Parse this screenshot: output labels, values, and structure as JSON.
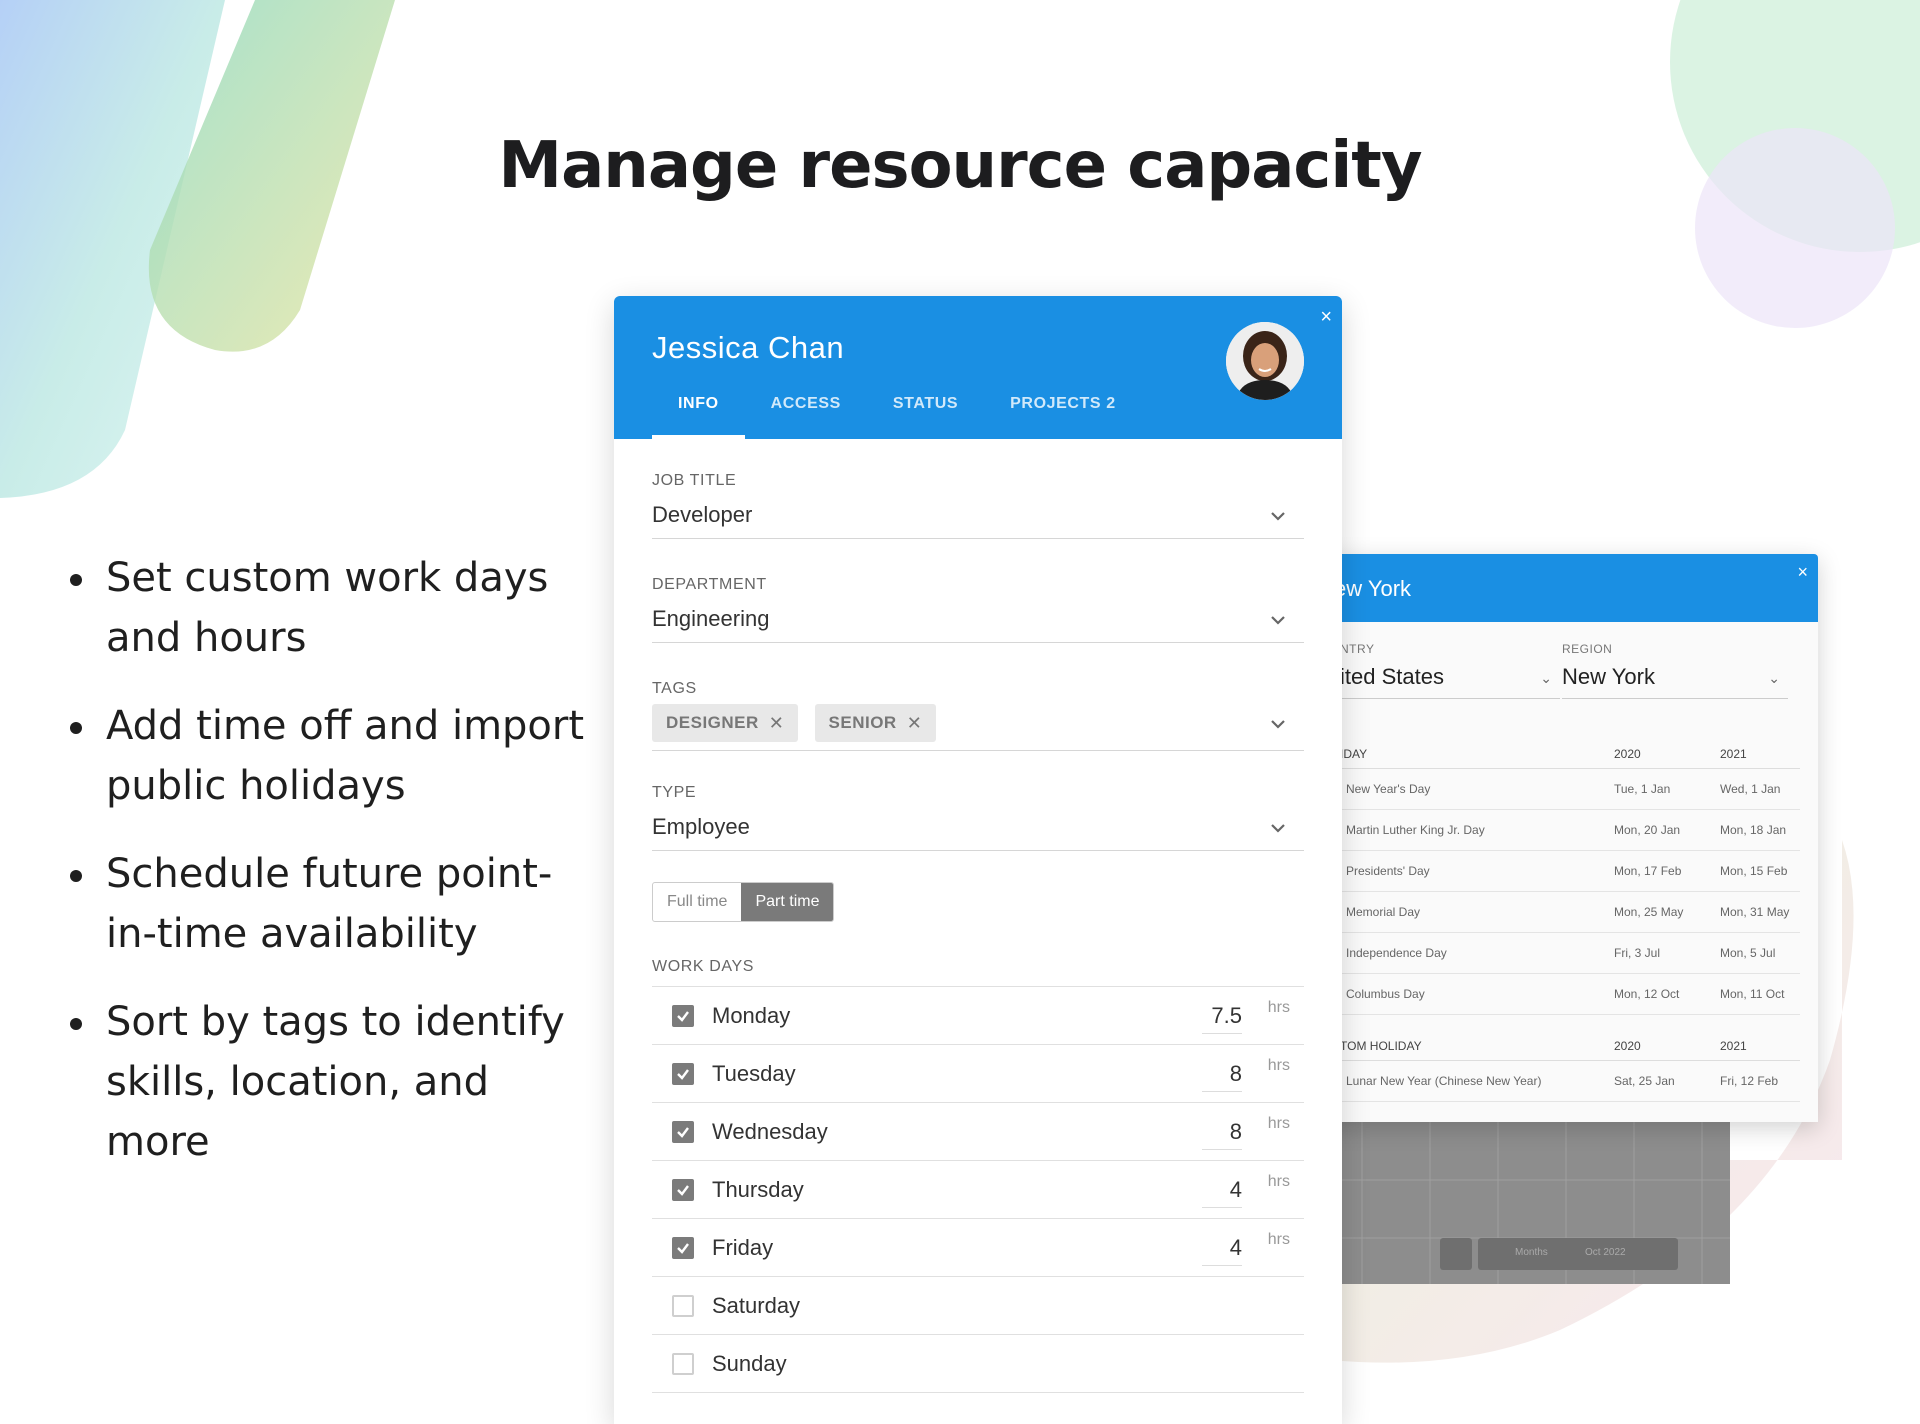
{
  "page": {
    "title": "Manage resource capacity",
    "bullets": [
      "Set custom work days and hours",
      "Add time off and import public holidays",
      "Schedule future point-in-time availability",
      "Sort by tags to identify skills, location, and more"
    ]
  },
  "main_card": {
    "name": "Jessica Chan",
    "close_symbol": "×",
    "tabs": [
      {
        "label": "INFO",
        "active": true
      },
      {
        "label": "ACCESS",
        "active": false
      },
      {
        "label": "STATUS",
        "active": false
      },
      {
        "label": "PROJECTS 2",
        "active": false
      }
    ],
    "job_title": {
      "label": "JOB TITLE",
      "value": "Developer"
    },
    "department": {
      "label": "DEPARTMENT",
      "value": "Engineering"
    },
    "tags": {
      "label": "TAGS",
      "items": [
        "DESIGNER",
        "SENIOR"
      ],
      "remove_symbol": "✕"
    },
    "type": {
      "label": "TYPE",
      "value": "Employee"
    },
    "employment_toggle": {
      "options": [
        "Full time",
        "Part time"
      ],
      "selected": "Part time"
    },
    "work_days": {
      "label": "WORK DAYS",
      "unit": "hrs",
      "days": [
        {
          "name": "Monday",
          "checked": true,
          "hours": "7.5"
        },
        {
          "name": "Tuesday",
          "checked": true,
          "hours": "8"
        },
        {
          "name": "Wednesday",
          "checked": true,
          "hours": "8"
        },
        {
          "name": "Thursday",
          "checked": true,
          "hours": "4"
        },
        {
          "name": "Friday",
          "checked": true,
          "hours": "4"
        },
        {
          "name": "Saturday",
          "checked": false,
          "hours": ""
        },
        {
          "name": "Sunday",
          "checked": false,
          "hours": ""
        }
      ]
    }
  },
  "holiday_card": {
    "title": "ew York",
    "close_symbol": "×",
    "country": {
      "label": "NTRY",
      "value": "ited States"
    },
    "region": {
      "label": "REGION",
      "value": "New York"
    },
    "public_holidays": {
      "headers": [
        "IDAY",
        "2020",
        "2021"
      ],
      "rows": [
        [
          "New Year's Day",
          "Tue, 1 Jan",
          "Wed, 1 Jan"
        ],
        [
          "Martin Luther King Jr. Day",
          "Mon, 20 Jan",
          "Mon, 18 Jan"
        ],
        [
          "Presidents' Day",
          "Mon, 17 Feb",
          "Mon, 15 Feb"
        ],
        [
          "Memorial Day",
          "Mon, 25 May",
          "Mon, 31 May"
        ],
        [
          "Independence Day",
          "Fri, 3 Jul",
          "Mon, 5 Jul"
        ],
        [
          "Columbus Day",
          "Mon, 12 Oct",
          "Mon, 11 Oct"
        ]
      ]
    },
    "custom_holidays": {
      "headers": [
        "TOM HOLIDAY",
        "2020",
        "2021"
      ],
      "rows": [
        [
          "Lunar New Year (Chinese New Year)",
          "Sat, 25 Jan",
          "Fri, 12 Feb"
        ]
      ]
    }
  },
  "background_ui": {
    "zoom_label": "Months",
    "date_label": "Oct 2022"
  },
  "colors": {
    "header_blue": "#1a8fe3",
    "checkbox_gray": "#7b7b7b",
    "tag_bg": "#e8e8e8"
  }
}
